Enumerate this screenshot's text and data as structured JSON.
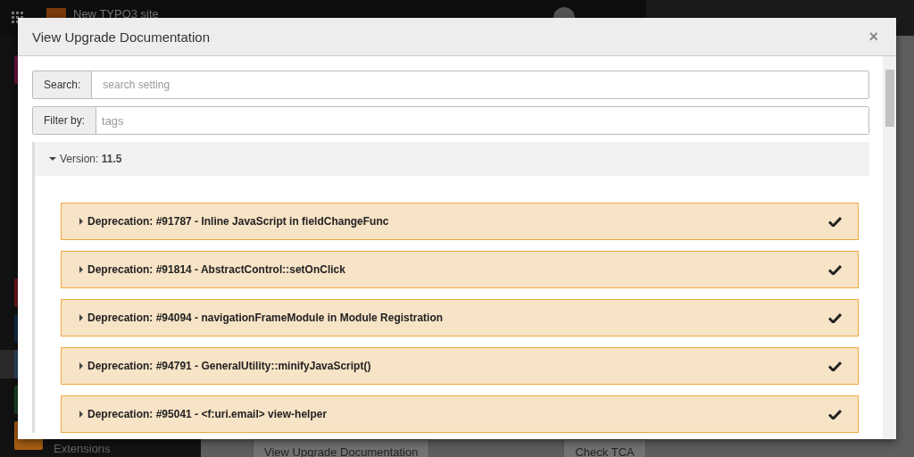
{
  "backend": {
    "site_name": "New TYPO3 site",
    "modules": [
      {
        "color": "#6b1440",
        "selected": false
      },
      {
        "color": "#6e1a1a",
        "selected": false
      },
      {
        "color": "#0f2b46",
        "selected": false
      },
      {
        "color": "#2a4766",
        "selected": true
      },
      {
        "color": "#1a4426",
        "selected": false
      },
      {
        "color": "#a85f14",
        "label": "Extensions",
        "selected": false
      }
    ],
    "buttons": [
      "View Upgrade Documentation",
      "Check TCA"
    ]
  },
  "modal": {
    "title": "View Upgrade Documentation",
    "close": "×",
    "search": {
      "label": "Search:",
      "placeholder": "search setting"
    },
    "filter": {
      "label": "Filter by:",
      "placeholder": "tags"
    },
    "version": {
      "label": "Version:",
      "value": "11.5",
      "expanded": true,
      "items": [
        {
          "title": "Deprecation: #91787 - Inline JavaScript in fieldChangeFunc",
          "expanded": false,
          "read": true
        },
        {
          "title": "Deprecation: #91814 - AbstractControl::setOnClick",
          "expanded": false,
          "read": true
        },
        {
          "title": "Deprecation: #94094 - navigationFrameModule in Module Registration",
          "expanded": false,
          "read": true
        },
        {
          "title": "Deprecation: #94791 - GeneralUtility::minifyJavaScript()",
          "expanded": false,
          "read": true
        },
        {
          "title": "Deprecation: #95041 - <f:uri.email> view-helper",
          "expanded": false,
          "read": true
        }
      ]
    }
  }
}
